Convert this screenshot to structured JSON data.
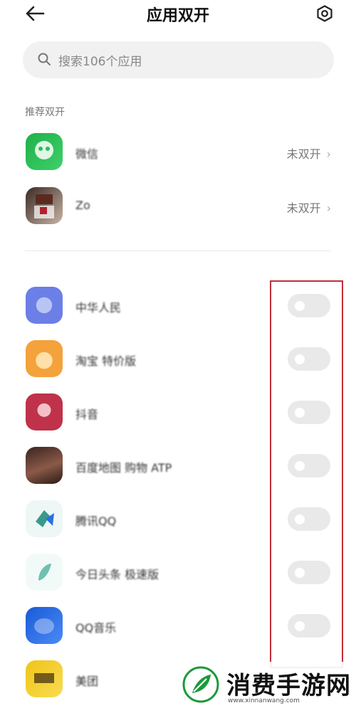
{
  "header": {
    "title": "应用双开",
    "back_icon": "arrow-left-icon",
    "settings_icon": "gear-icon"
  },
  "search": {
    "placeholder": "搜索106个应用",
    "icon": "search-icon"
  },
  "recommended": {
    "section_label": "推荐双开",
    "items": [
      {
        "name": "微信",
        "status": "未双开",
        "icon_color": "#2dbd55"
      },
      {
        "name": "Zo",
        "status": "未双开",
        "icon_color": "#7a3b2e"
      }
    ]
  },
  "apps": [
    {
      "name": "中华人民",
      "icon_color": "#6b7fe6",
      "enabled": false
    },
    {
      "name": "淘宝 特价版",
      "icon_color": "#f4a23b",
      "enabled": false
    },
    {
      "name": "抖音",
      "icon_color": "#c0324a",
      "enabled": false
    },
    {
      "name": "百度地图 购物 ATP",
      "icon_color": "#5a3a2e",
      "enabled": false
    },
    {
      "name": "腾讯QQ",
      "icon_color": "#3a9a8a",
      "enabled": false
    },
    {
      "name": "今日头条 极速版",
      "icon_color": "#6fc0b0",
      "enabled": false
    },
    {
      "name": "QQ音乐",
      "icon_color": "#2b6fe6",
      "enabled": false
    },
    {
      "name": "美团",
      "icon_color": "#f0c419",
      "enabled": false
    }
  ],
  "watermark": {
    "text": "消费手游网",
    "url": "www.xinnanwang.com"
  }
}
